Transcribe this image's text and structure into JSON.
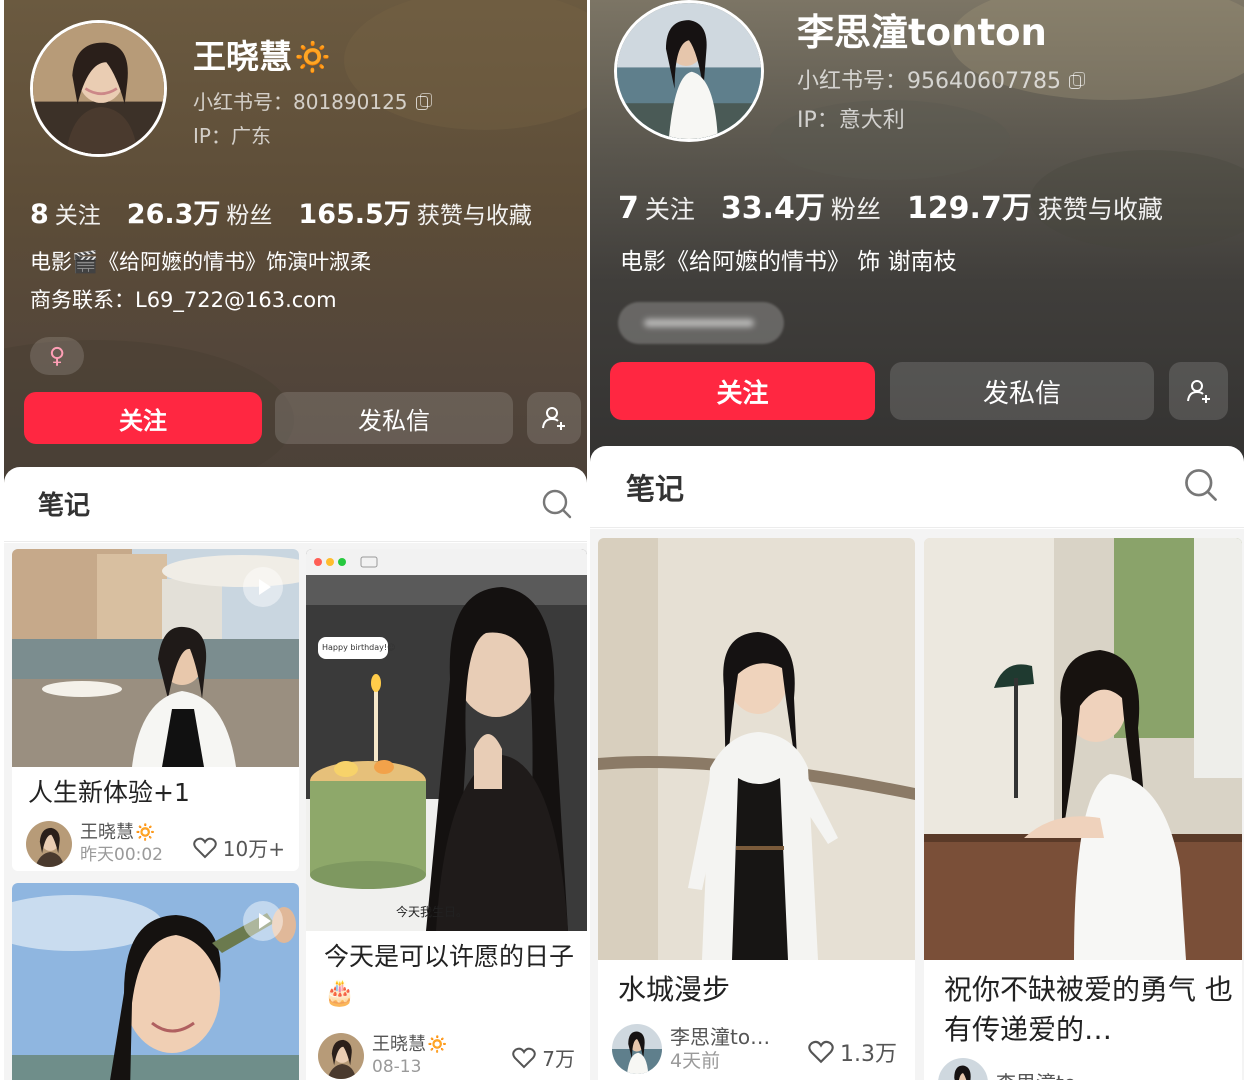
{
  "left": {
    "name": "王晓慧",
    "name_badge": "🔅",
    "account_id": "小红书号：801890125",
    "ip": "IP：广东",
    "stats": [
      {
        "num": "8",
        "label": "关注"
      },
      {
        "num": "26.3万",
        "label": "粉丝"
      },
      {
        "num": "165.5万",
        "label": "获赞与收藏"
      }
    ],
    "bio_line1": "电影🎬《给阿嬷的情书》饰演叶淑柔",
    "bio_line2": "商务联系：L69_722@163.com",
    "gender": "♀",
    "follow_label": "关注",
    "dm_label": "发私信",
    "tab_label": "笔记",
    "cards": [
      {
        "title": "人生新体验+1",
        "author": "王晓慧",
        "author_badge": "🔅",
        "time": "昨天00:02",
        "likes": "10万+"
      },
      {
        "title": "今天是可以许愿的日子🎂",
        "author": "王晓慧",
        "author_badge": "🔅",
        "time": "08-13",
        "likes": "7万",
        "bubble": "Happy birthday!☺",
        "caption": "今天我生日。"
      },
      {
        "title": ""
      }
    ]
  },
  "right": {
    "name": "李思潼tonton",
    "account_id": "小红书号：95640607785",
    "ip": "IP：意大利",
    "stats": [
      {
        "num": "7",
        "label": "关注"
      },
      {
        "num": "33.4万",
        "label": "粉丝"
      },
      {
        "num": "129.7万",
        "label": "获赞与收藏"
      }
    ],
    "bio_line1": "电影《给阿嬷的情书》 饰 谢南枝",
    "follow_label": "关注",
    "dm_label": "发私信",
    "tab_label": "笔记",
    "cards": [
      {
        "title": "水城漫步",
        "author": "李思潼to…",
        "time": "4天前",
        "likes": "1.3万"
      },
      {
        "title": "祝你不缺被爱的勇气 也有传递爱的…",
        "author": "李思潼to…"
      }
    ]
  },
  "colors": {
    "accent": "#ff2741",
    "text_dark": "#222222",
    "muted": "#9a9a9a"
  },
  "icons": [
    "copy-icon",
    "add-friend-icon",
    "search-icon",
    "heart-icon",
    "play-icon",
    "female-icon"
  ]
}
